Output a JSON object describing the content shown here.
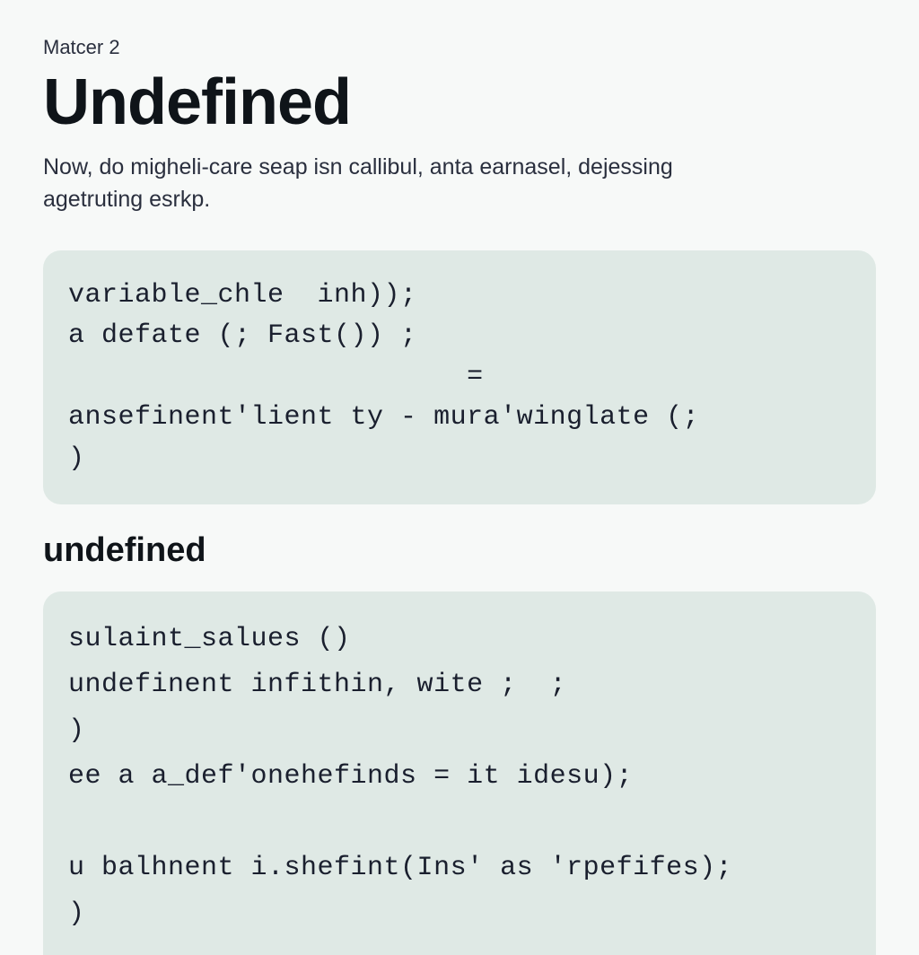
{
  "eyebrow": "Matcer 2",
  "title": "Undefined",
  "description": "Now, do migheli-care seap isn callibul, anta earnasel, dejessing agetruting esrkp.",
  "code1": "variable_chle  inh));\na defate (; Fast()) ;\n                        =\nansefinent'lient ty - mura'winglate (;\n)",
  "subheading": "undefined",
  "code2": "sulaint_salues ()\nundefinent infithin, wite ;  ;\n)\nee a a_def'onehefinds = it idesu);\n\nu balhnent i.shefint(Ins' as 'rpefifes);\n)"
}
